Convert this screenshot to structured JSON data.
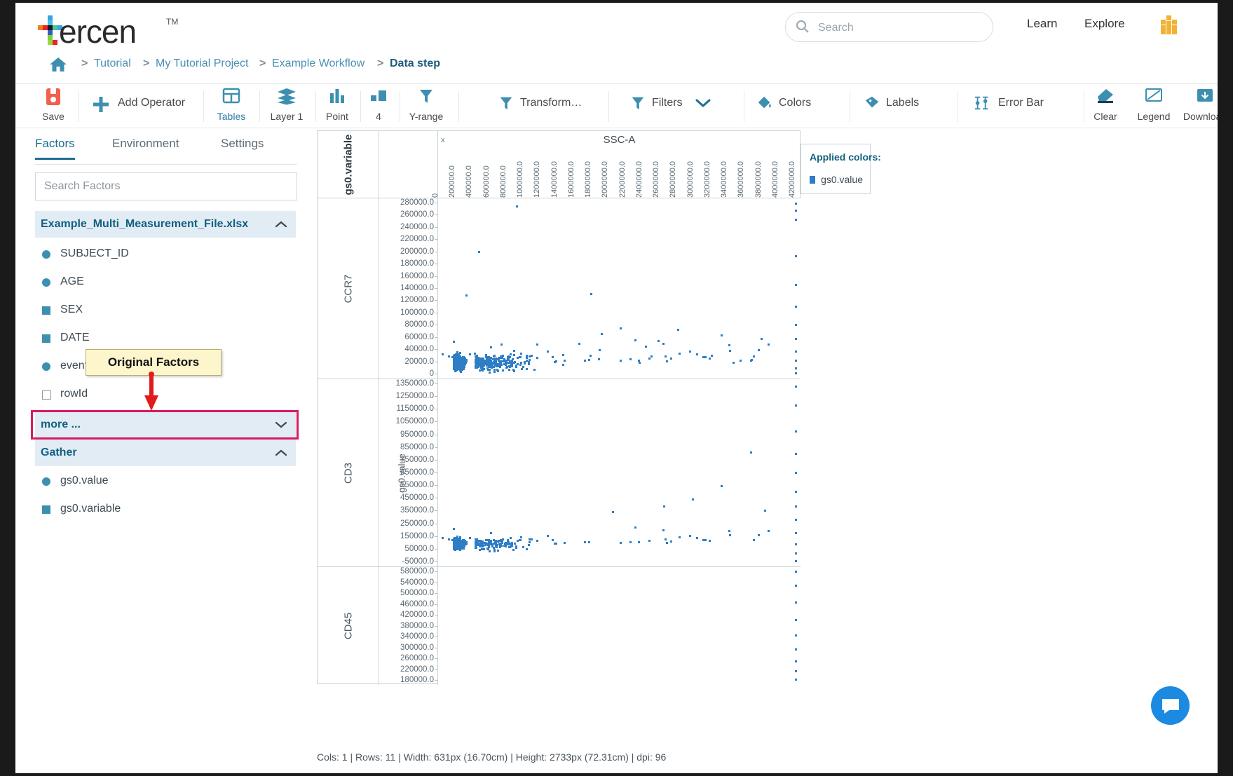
{
  "header": {
    "logo_text": "ercen",
    "logo_tm": "TM",
    "search": {
      "placeholder": "Search",
      "value": ""
    },
    "nav": [
      {
        "id": "learn",
        "label": "Learn"
      },
      {
        "id": "explore",
        "label": "Explore"
      }
    ],
    "avatar_icon": "user-avatar-icon"
  },
  "breadcrumb": {
    "home_icon": "home-icon",
    "items": [
      "Tutorial",
      "My Tutorial Project",
      "Example Workflow",
      "Data step"
    ],
    "separator": ">",
    "current": "Data step"
  },
  "toolbar": {
    "buttons": [
      {
        "id": "save",
        "label": "Save",
        "icon": "save-icon",
        "active": false
      },
      {
        "id": "add-operator",
        "label": "Add Operator",
        "icon": "plus-icon",
        "inline": true
      },
      {
        "id": "tables",
        "label": "Tables",
        "icon": "table-icon",
        "active": true
      },
      {
        "id": "layer1",
        "label": "Layer 1",
        "icon": "layers-icon",
        "active": false
      },
      {
        "id": "point",
        "label": "Point",
        "icon": "bar-chart-icon",
        "active": false
      },
      {
        "id": "size",
        "label": "4",
        "icon": "size-icon",
        "active": false
      },
      {
        "id": "y-range",
        "label": "Y-range",
        "icon": "funnel-icon",
        "active": false
      },
      {
        "id": "transform",
        "label": "Transform…",
        "icon": "funnel-icon",
        "inline": true
      },
      {
        "id": "filters",
        "label": "Filters",
        "icon": "funnel-icon",
        "inline": true,
        "chevron": true
      },
      {
        "id": "colors",
        "label": "Colors",
        "icon": "paint-drop-icon",
        "inline": true
      },
      {
        "id": "labels",
        "label": "Labels",
        "icon": "tag-icon",
        "inline": true
      },
      {
        "id": "error-bar",
        "label": "Error Bar",
        "icon": "error-bar-icon",
        "inline": true
      },
      {
        "id": "clear",
        "label": "Clear",
        "icon": "eraser-icon",
        "active": false
      },
      {
        "id": "legend",
        "label": "Legend",
        "icon": "legend-icon",
        "active": false
      },
      {
        "id": "download",
        "label": "Download",
        "icon": "download-icon",
        "active": false
      }
    ]
  },
  "sidebar": {
    "tabs": [
      {
        "id": "factors",
        "label": "Factors",
        "active": true
      },
      {
        "id": "environment",
        "label": "Environment",
        "active": false
      },
      {
        "id": "settings",
        "label": "Settings",
        "active": false
      }
    ],
    "search": {
      "placeholder": "Search Factors",
      "value": ""
    },
    "groups": [
      {
        "id": "file-group",
        "label": "Example_Multi_Measurement_File.xlsx",
        "chevron": "chevron-up-icon",
        "items": [
          {
            "label": "SUBJECT_ID",
            "marker": "circle"
          },
          {
            "label": "AGE",
            "marker": "circle"
          },
          {
            "label": "SEX",
            "marker": "square"
          },
          {
            "label": "DATE",
            "marker": "square"
          },
          {
            "label": "event_id",
            "marker": "circle"
          },
          {
            "label": "rowId",
            "marker": "square-outline"
          }
        ]
      },
      {
        "id": "more-group",
        "label": "more ...",
        "chevron": "chevron-down-icon",
        "highlighted": true,
        "items": []
      },
      {
        "id": "gather-group",
        "label": "Gather",
        "chevron": "chevron-up-icon",
        "items": [
          {
            "label": "gs0.value",
            "marker": "circle"
          },
          {
            "label": "gs0.variable",
            "marker": "square"
          }
        ]
      }
    ],
    "annotation": {
      "text": "Original Factors",
      "arrow_color": "#e01b1b",
      "highlight_color": "#d81b60"
    }
  },
  "legend_panel": {
    "title": "Applied colors:",
    "entries": [
      {
        "label": "gs0.value",
        "color": "#2f7dc4"
      }
    ]
  },
  "status_bar": {
    "text": "Cols: 1 | Rows: 11 | Width: 631px (16.70cm) | Height: 2733px (72.31cm) | dpi: 96"
  },
  "chat": {
    "icon": "chat-bubble-icon",
    "color": "#1b8ae0"
  },
  "chart_data": {
    "type": "scatter",
    "title": "",
    "column_header": "gs0.variable",
    "xlabel": "SSC-A",
    "ylabel": "gs0.value",
    "point_color": "#2f7dc4",
    "grid": false,
    "x_close_icon": "x",
    "xlim": [
      0,
      42000000
    ],
    "xticks": [
      "0",
      "200000.0",
      "400000.0",
      "600000.0",
      "800000.0",
      "1000000.0",
      "1200000.0",
      "1400000.0",
      "1600000.0",
      "1800000.0",
      "2000000.0",
      "2200000.0",
      "2400000.0",
      "2600000.0",
      "2800000.0",
      "3000000.0",
      "3200000.0",
      "3400000.0",
      "3600000.0",
      "3800000.0",
      "4000000.0",
      "4200000.0"
    ],
    "panels": [
      {
        "row_label": "CCR7",
        "ylim": [
          0,
          290000
        ],
        "yticks": [
          "280000.0",
          "260000.0",
          "240000.0",
          "220000.0",
          "200000.0",
          "180000.0",
          "160000.0",
          "140000.0",
          "120000.0",
          "100000.0",
          "80000.0",
          "60000.0",
          "40000.0",
          "20000.0",
          "0"
        ],
        "n_points": 1400,
        "cluster": {
          "x_mode": 0.04,
          "x_spread": 0.1,
          "y_mode": 0.09,
          "y_spread": 0.07
        },
        "outlier_column_x": 0.985
      },
      {
        "row_label": "CD3",
        "ylim": [
          -50000,
          1400000
        ],
        "yticks": [
          "1350000.0",
          "1250000.0",
          "1150000.0",
          "1050000.0",
          "950000.0",
          "850000.0",
          "750000.0",
          "650000.0",
          "550000.0",
          "450000.0",
          "350000.0",
          "250000.0",
          "150000.0",
          "50000.0",
          "-50000.0"
        ],
        "n_points": 1400,
        "cluster": {
          "x_mode": 0.04,
          "x_spread": 0.1,
          "y_mode": 0.12,
          "y_spread": 0.05
        },
        "outlier_column_x": 0.985
      },
      {
        "row_label": "CD45",
        "ylim": [
          160000,
          600000
        ],
        "yticks": [
          "580000.0",
          "540000.0",
          "500000.0",
          "460000.0",
          "420000.0",
          "380000.0",
          "340000.0",
          "300000.0",
          "260000.0",
          "220000.0",
          "180000.0"
        ],
        "n_points": 0,
        "cluster": null,
        "outlier_column_x": 0.985
      }
    ]
  }
}
